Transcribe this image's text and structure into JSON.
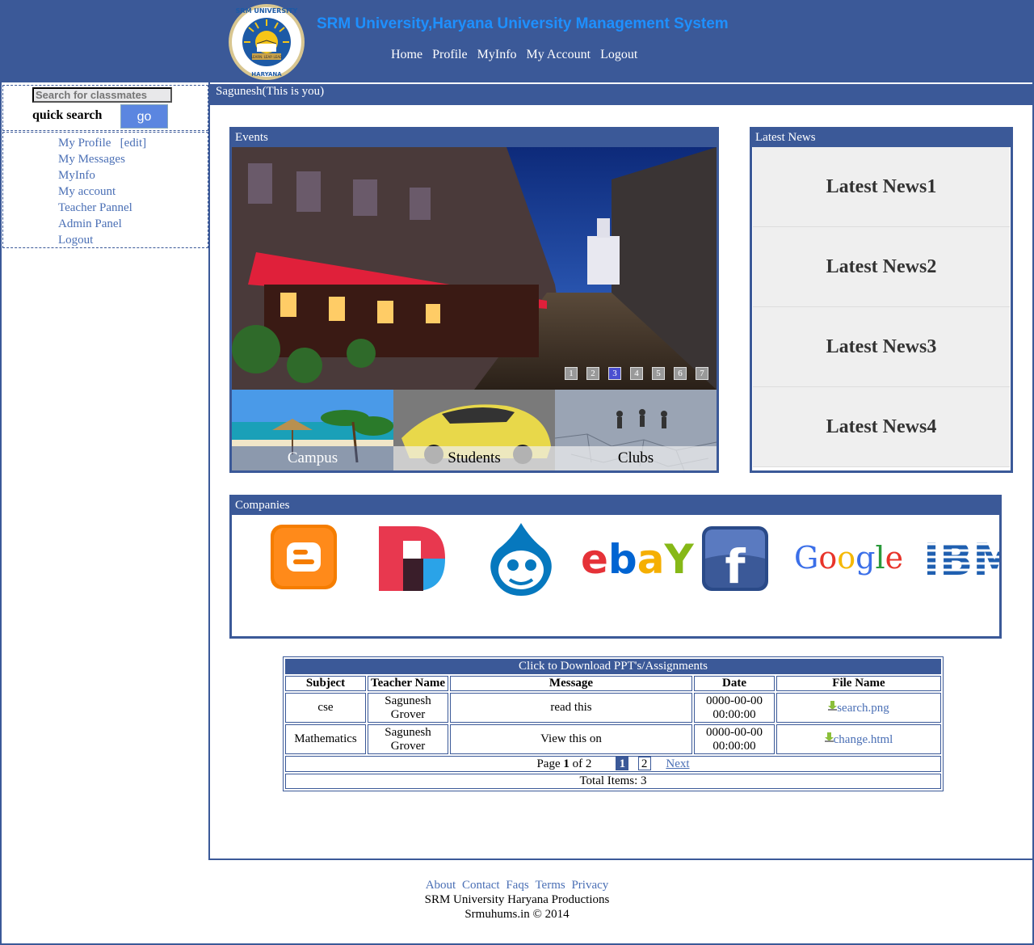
{
  "header": {
    "title": "SRM University,Haryana University Management System",
    "logo_text_top": "SRM UNIVERSITY",
    "logo_text_bottom": "HARYANA",
    "logo_motto": "LEARN. LEAP. LEAD",
    "nav": [
      "Home",
      "Profile",
      "MyInfo",
      "My Account",
      "Logout"
    ]
  },
  "sidebar": {
    "search_placeholder": "Search for classmates",
    "quick_search_label": "quick search",
    "go_label": "go",
    "menu": {
      "my_profile": "My Profile",
      "edit": "[edit]",
      "my_messages": "My Messages",
      "myinfo": "MyInfo",
      "my_account": "My account",
      "teacher_pannel": "Teacher Pannel",
      "admin_panel": "Admin Panel",
      "logout": "Logout"
    }
  },
  "user_bar": "Sagunesh(This is you)",
  "events": {
    "title": "Events",
    "slides": [
      "1",
      "2",
      "3",
      "4",
      "5",
      "6",
      "7"
    ],
    "active_slide": 3,
    "thumbs": [
      "Campus",
      "Students",
      "Clubs"
    ]
  },
  "news": {
    "title": "Latest News",
    "items": [
      "Latest News1",
      "Latest News2",
      "Latest News3",
      "Latest News4"
    ]
  },
  "companies": {
    "title": "Companies",
    "logos": [
      "blogger-logo",
      "readability-logo",
      "drupal-logo",
      "ebay-logo",
      "facebook-logo",
      "google-logo",
      "ibm-logo"
    ],
    "ebay_text": "ebaY",
    "facebook_text": "f",
    "google_text": "Google",
    "ibm_text": "IBM"
  },
  "downloads": {
    "caption": "Click to Download PPT's/Assignments",
    "headers": [
      "Subject",
      "Teacher Name",
      "Message",
      "Date",
      "File Name"
    ],
    "rows": [
      {
        "subject": "cse",
        "teacher": "Sagunesh Grover",
        "message": "read this",
        "date": "0000-00-00 00:00:00",
        "file": "search.png"
      },
      {
        "subject": "Mathematics",
        "teacher": "Sagunesh Grover",
        "message": "View this on",
        "date": "0000-00-00 00:00:00",
        "file": "change.html"
      }
    ],
    "page_label": "Page",
    "page_current": "1",
    "page_of": "of 2",
    "pages": [
      "1",
      "2"
    ],
    "next_label": "Next",
    "total_label": "Total Items: 3"
  },
  "footer": {
    "links": [
      "About",
      "Contact",
      "Faqs",
      "Terms",
      "Privacy"
    ],
    "line1": "SRM University Haryana Productions",
    "line2": "Srmuhums.in © 2014"
  },
  "colors": {
    "brand": "#3b5998",
    "title_blue": "#1e90ff",
    "link": "#4a6fb5",
    "go_button": "#5b86e0"
  }
}
